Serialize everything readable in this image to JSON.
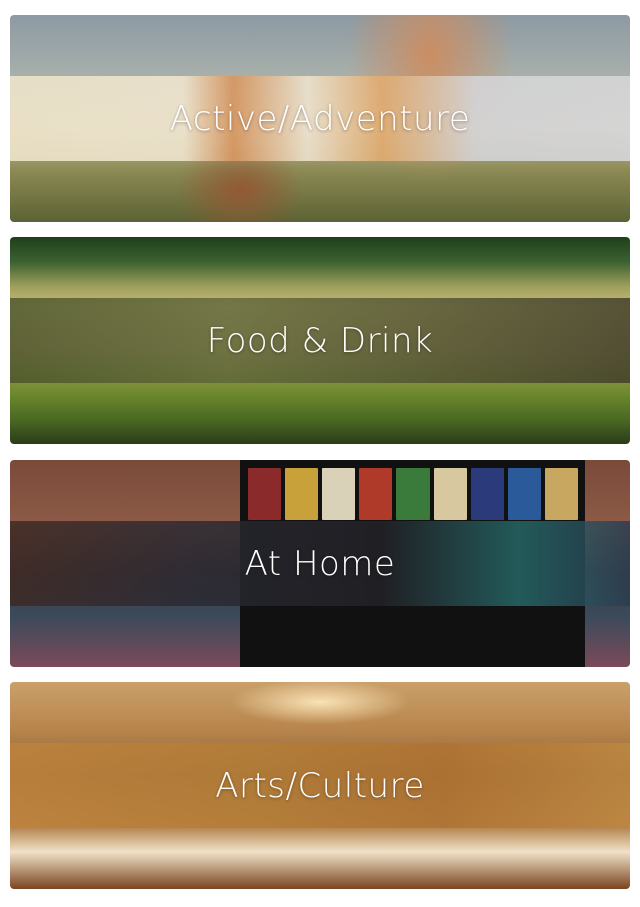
{
  "categories": [
    {
      "label": "Active/Adventure",
      "icon": "hiking-photo"
    },
    {
      "label": "Food & Drink",
      "icon": "vineyard-photo"
    },
    {
      "label": "At Home",
      "icon": "movie-night-photo"
    },
    {
      "label": "Arts/Culture",
      "icon": "concert-hall-photo"
    }
  ],
  "colors": {
    "label_text": "#ffffff",
    "page_background": "#ffffff"
  }
}
